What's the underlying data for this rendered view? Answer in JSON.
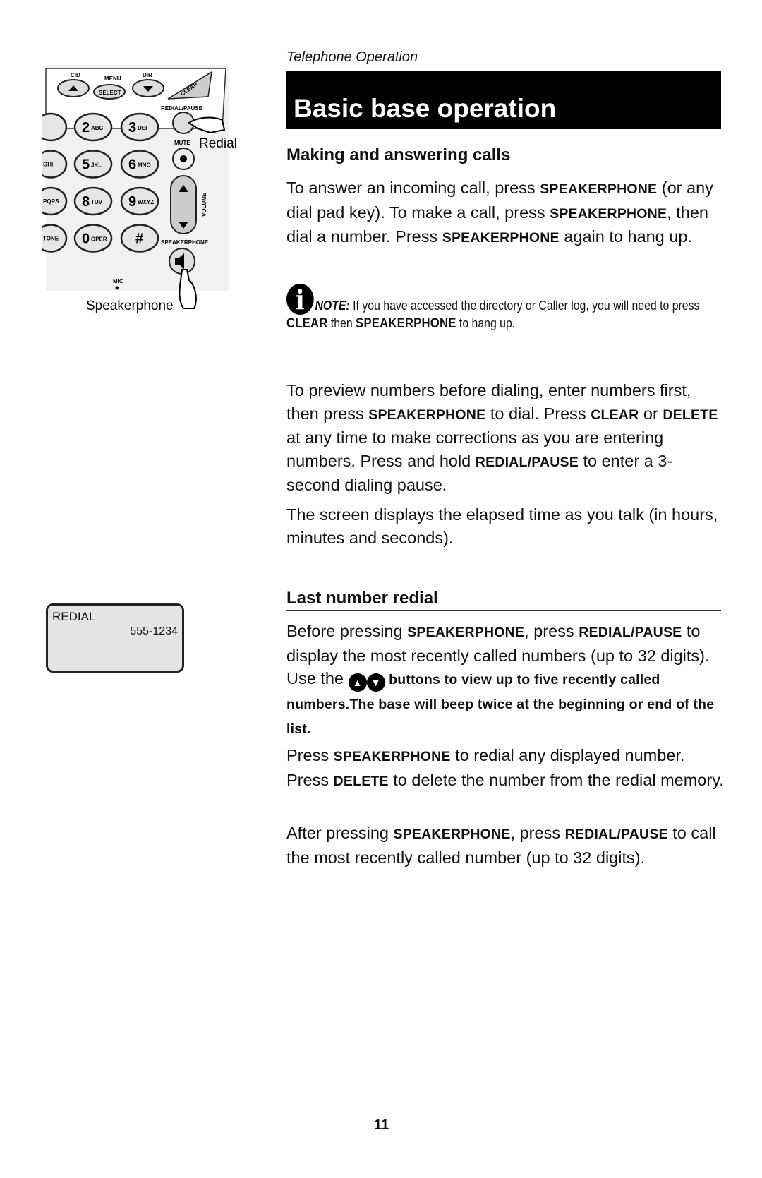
{
  "header": {
    "section": "Telephone Operation",
    "title": "Basic base operation"
  },
  "figure": {
    "labels": {
      "cid": "CID",
      "menu": "MENU",
      "select": "SELECT",
      "dir": "DIR",
      "clear": "CLEAR",
      "redial_pause": "REDIAL/PAUSE",
      "mute": "MUTE",
      "volume": "VOLUME",
      "speakerphone": "SPEAKERPHONE",
      "mic": "MIC"
    },
    "keys": [
      [
        "",
        "2",
        "ABC"
      ],
      [
        "",
        "3",
        "DEF"
      ],
      [
        "GHI",
        "5",
        "JKL"
      ],
      [
        "",
        "6",
        "MNO"
      ],
      [
        "PQRS",
        "8",
        "TUV"
      ],
      [
        "",
        "9",
        "WXYZ"
      ],
      [
        "TONE",
        "0",
        "OPER"
      ],
      [
        "",
        "#",
        ""
      ]
    ],
    "callouts": {
      "redial": "Redial",
      "speakerphone": "Speakerphone"
    }
  },
  "lcd": {
    "line1": "REDIAL",
    "number": "555-1234"
  },
  "s1": {
    "heading": "Making and answering calls",
    "p1": [
      "To answer an incoming call, press ",
      "SPEAKERPHONE",
      " (or any dial pad key). To make a call, press ",
      "SPEAKERPHONE",
      ", then dial a number. Press ",
      "SPEAKERPHONE",
      " again to hang up."
    ],
    "note": [
      "NOTE:",
      " If you have accessed the directory or Caller log, you will need to press ",
      "CLEAR",
      " then ",
      "SPEAKERPHONE",
      " to hang up."
    ],
    "p2": [
      "To preview numbers before dialing, enter numbers first, then press ",
      "SPEAKERPHONE",
      " to dial. Press ",
      "CLEAR",
      " or ",
      "DELETE",
      " at any time to make corrections as you are entering numbers. Press and hold ",
      "REDIAL/PAUSE",
      " to enter a 3-second dialing pause."
    ],
    "p3": "The screen displays the elapsed time as you talk (in hours, minutes and seconds)."
  },
  "s2": {
    "heading": "Last number redial",
    "p1": [
      "Before pressing ",
      "SPEAKERPHONE",
      ", press ",
      "REDIAL/PAUSE",
      " to display the most recently called numbers (up to 32 digits). Use the ",
      "▲",
      "▼",
      " buttons to view up to five recently called numbers.The base will beep twice at the beginning or end of the list."
    ],
    "p2": [
      "Press ",
      "SPEAKERPHONE",
      " to redial any displayed number. Press ",
      "DELETE",
      " to delete the number from the redial memory."
    ],
    "p3": [
      "After pressing ",
      "SPEAKERPHONE",
      ", press ",
      "REDIAL/PAUSE",
      " to call the most recently called number (up to 32 digits)."
    ]
  },
  "footer": {
    "page": "11"
  }
}
